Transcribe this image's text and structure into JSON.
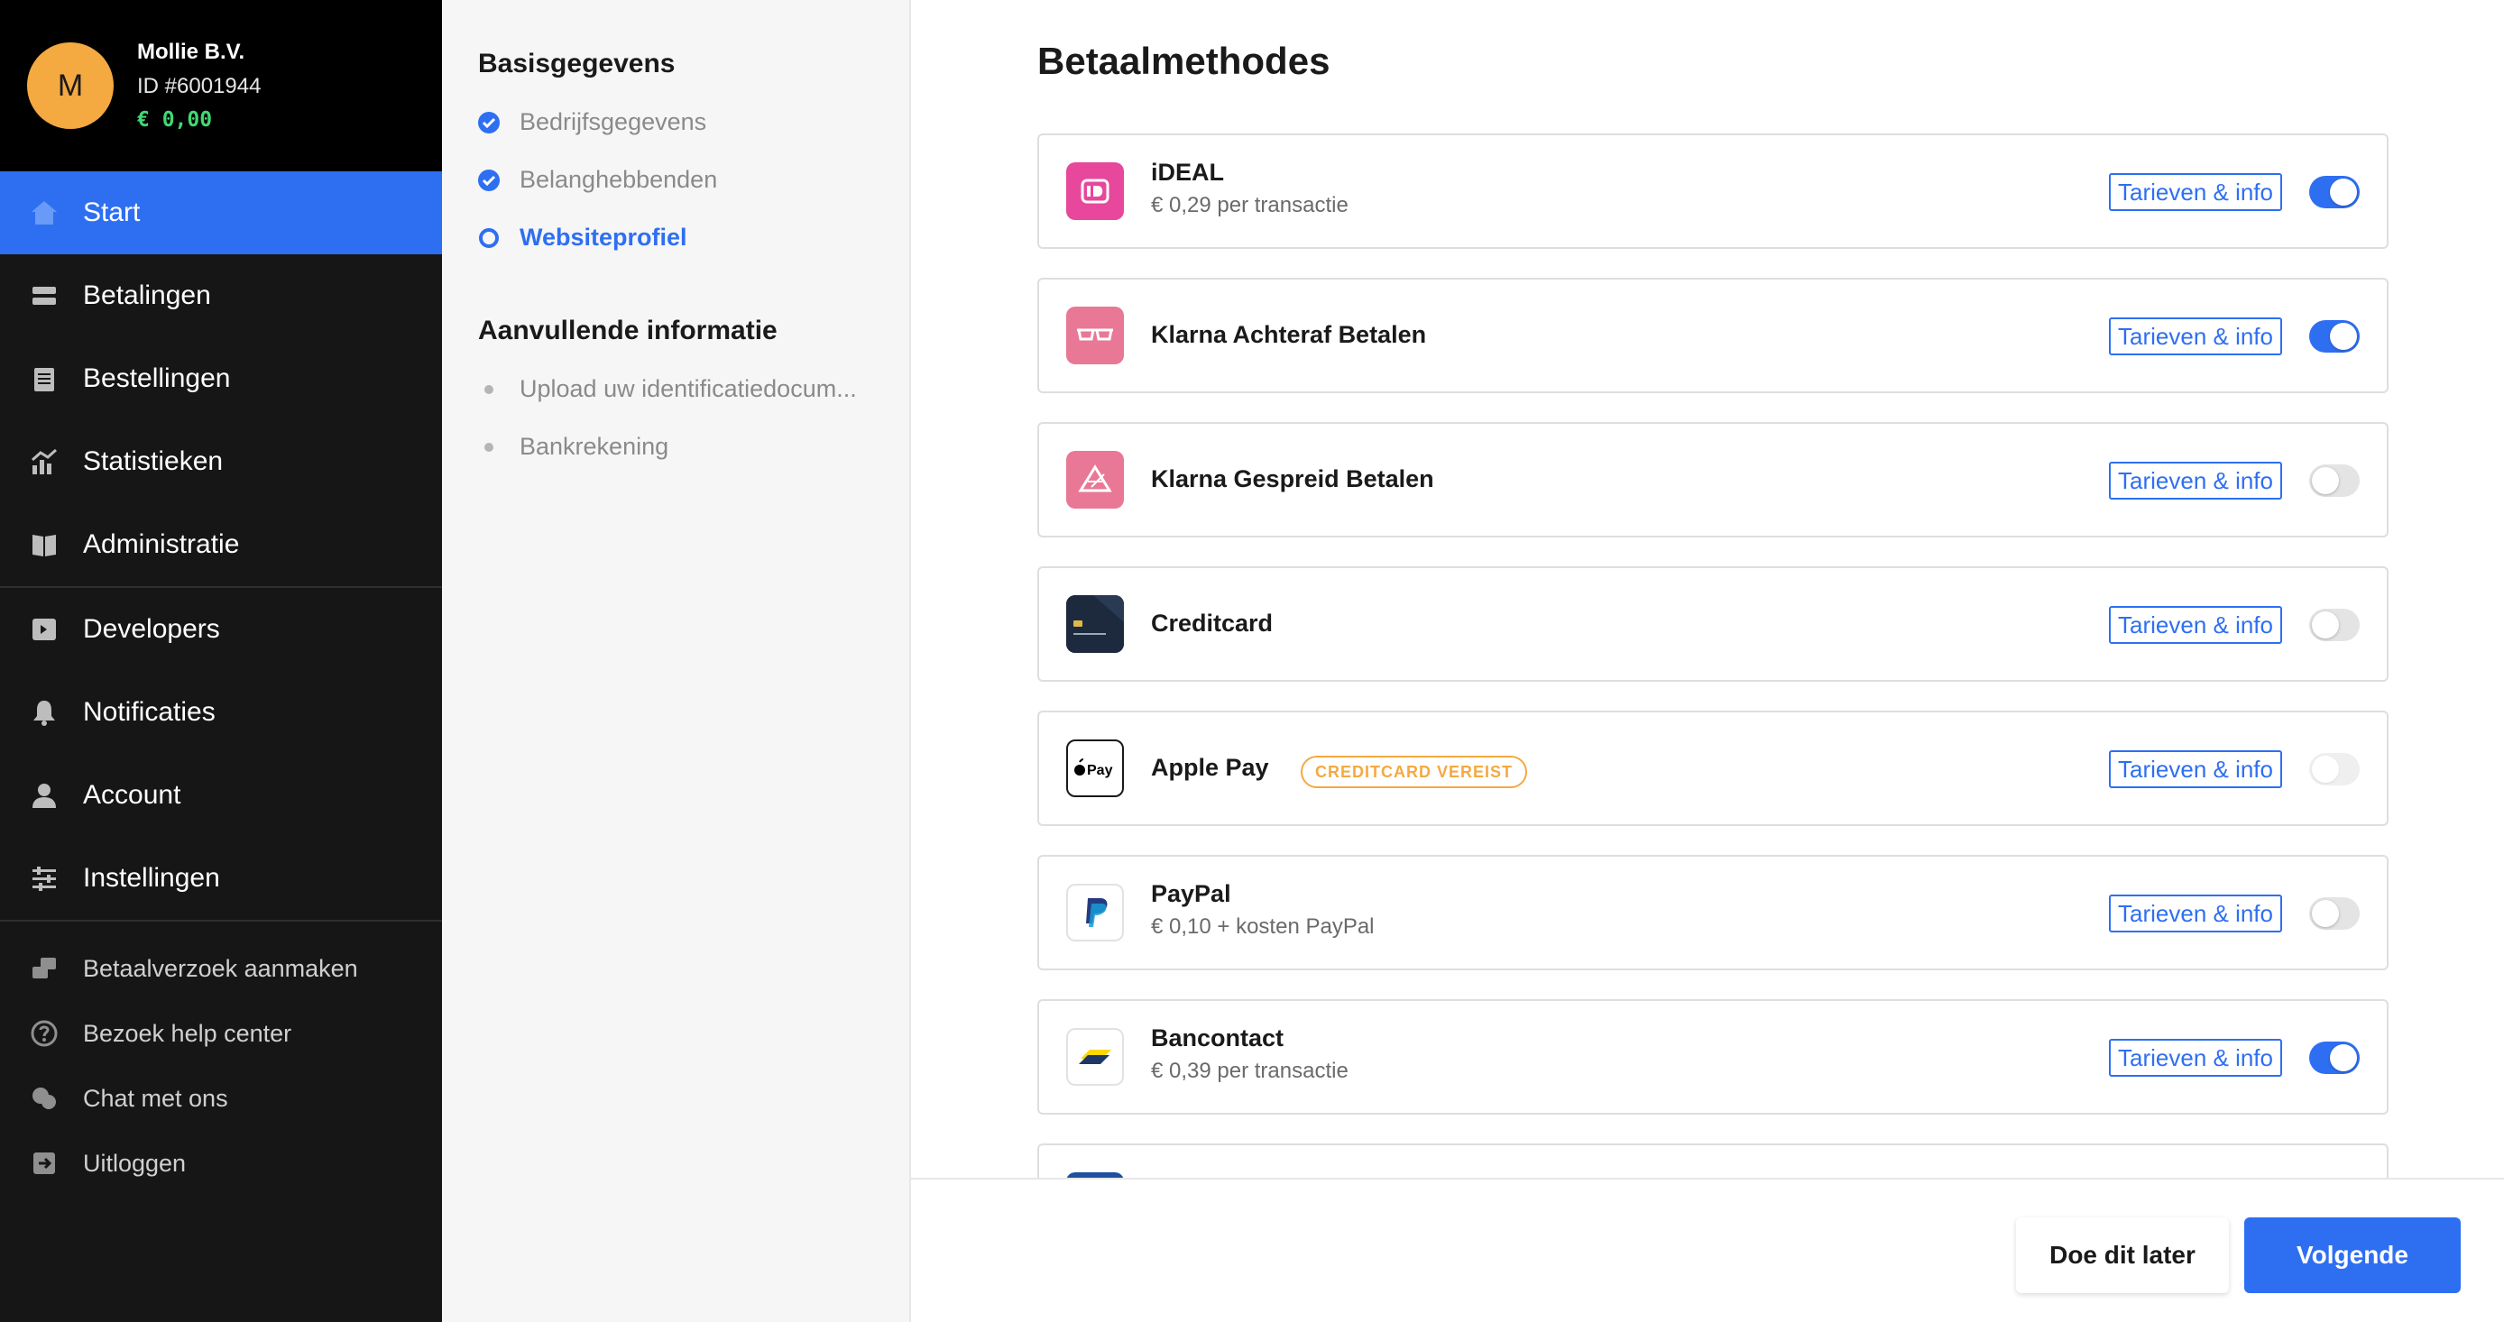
{
  "profile": {
    "initial": "M",
    "name": "Mollie B.V.",
    "id": "ID #6001944",
    "balance": "€ 0,00"
  },
  "nav": {
    "main": [
      {
        "label": "Start",
        "icon": "home-icon",
        "active": true
      },
      {
        "label": "Betalingen",
        "icon": "payments-icon"
      },
      {
        "label": "Bestellingen",
        "icon": "orders-icon"
      },
      {
        "label": "Statistieken",
        "icon": "statistics-icon"
      },
      {
        "label": "Administratie",
        "icon": "book-icon"
      }
    ],
    "secondary": [
      {
        "label": "Developers",
        "icon": "code-icon"
      },
      {
        "label": "Notificaties",
        "icon": "bell-icon"
      },
      {
        "label": "Account",
        "icon": "user-icon"
      },
      {
        "label": "Instellingen",
        "icon": "sliders-icon"
      }
    ],
    "utility": [
      {
        "label": "Betaalverzoek aanmaken",
        "icon": "payment-request-icon"
      },
      {
        "label": "Bezoek help center",
        "icon": "help-icon"
      },
      {
        "label": "Chat met ons",
        "icon": "chat-icon"
      },
      {
        "label": "Uitloggen",
        "icon": "logout-icon"
      }
    ]
  },
  "steps": {
    "basis_title": "Basisgegevens",
    "basis": [
      {
        "label": "Bedrijfsgegevens",
        "state": "done"
      },
      {
        "label": "Belanghebbenden",
        "state": "done"
      },
      {
        "label": "Websiteprofiel",
        "state": "current"
      }
    ],
    "extra_title": "Aanvullende informatie",
    "extra": [
      {
        "label": "Upload uw identificatiedocum...",
        "state": "todo"
      },
      {
        "label": "Bankrekening",
        "state": "todo"
      }
    ]
  },
  "main": {
    "title": "Betaalmethodes",
    "info_label": "Tarieven & info",
    "methods": [
      {
        "name": "iDEAL",
        "sub": "€ 0,29 per transactie",
        "enabled": true,
        "logo": "ideal-logo-icon"
      },
      {
        "name": "Klarna Achteraf Betalen",
        "sub": "",
        "enabled": true,
        "logo": "klarna-glasses-icon"
      },
      {
        "name": "Klarna Gespreid Betalen",
        "sub": "",
        "enabled": false,
        "logo": "klarna-pizza-icon"
      },
      {
        "name": "Creditcard",
        "sub": "",
        "enabled": false,
        "logo": "creditcard-icon"
      },
      {
        "name": "Apple Pay",
        "sub": "",
        "enabled": false,
        "disabled": true,
        "badge": "CREDITCARD VEREIST",
        "logo": "apple-pay-icon"
      },
      {
        "name": "PayPal",
        "sub": "€ 0,10 + kosten PayPal",
        "enabled": false,
        "logo": "paypal-icon"
      },
      {
        "name": "Bancontact",
        "sub": "€ 0,39 per transactie",
        "enabled": true,
        "logo": "bancontact-icon"
      }
    ]
  },
  "footer": {
    "later_label": "Doe dit later",
    "next_label": "Volgende"
  },
  "colors": {
    "accent": "#2e6ff2",
    "nav_bg": "#161616",
    "avatar": "#f4a941",
    "balance": "#3fd973",
    "badge": "#f4a941"
  }
}
